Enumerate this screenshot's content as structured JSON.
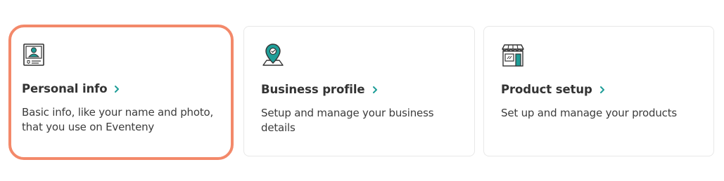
{
  "colors": {
    "accent": "#1f9e98",
    "highlight_border": "#f3896a",
    "text": "#333333"
  },
  "cards": [
    {
      "icon": "id-card-icon",
      "title": "Personal info",
      "description": "Basic info, like your name and photo, that you use on Eventeny",
      "selected": true
    },
    {
      "icon": "map-pin-icon",
      "title": "Business profile",
      "description": "Setup and manage your business details",
      "selected": false
    },
    {
      "icon": "storefront-icon",
      "title": "Product setup",
      "description": "Set up and manage your products",
      "selected": false
    }
  ]
}
